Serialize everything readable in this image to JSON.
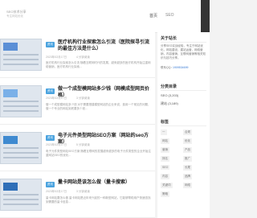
{
  "header": {
    "site_title": "SEO技术分享",
    "site_subtitle": "专注网站优化",
    "nav_home": "首页",
    "nav_more": "SEO"
  },
  "posts": [
    {
      "badge": "资讯",
      "title": "医疗机构行业探索怎么引流（医院探寻引流的最佳方法是什么）",
      "date": "2023年02月17日",
      "meta": "4 分钟阅读",
      "excerpt": "医疗机构行业探索怎么引流 随着互联网时代的发展，越来越多的医疗机构开始注重网络营销，医疗机构行业探索..."
    },
    {
      "badge": "资讯",
      "title": "做一个成型模网站多少钱（网模成型网页价格）",
      "date": "2023年02月17日",
      "meta": "3 分钟阅读",
      "excerpt": "做一个成型模网站多少钱 对于需要搭建模型网站的企业来说，费用一个常见的问题，做一个专业的网站到底要多少钱..."
    },
    {
      "badge": "资讯",
      "title": "电子元件类型网站SEO方案（网站的seo方案）",
      "date": "2023年02月17日",
      "meta": "5 分钟阅读",
      "excerpt": "电子元件类型网站SEO方案 随着互联网的发展越来越多的电子元件类型的企业开始注重网站SEO的优化..."
    },
    {
      "badge": "资讯",
      "title": "量卡网站是该怎么做（量卡搜索）",
      "date": "2023年02月17日",
      "meta": "3 分钟阅读",
      "excerpt": "量卡网站要怎么做 量卡网站是近年来兴起的一种新型网站，它能够帮助用户快速查找到需要的量卡信息..."
    }
  ],
  "sidebar": {
    "about_heading": "关于站长",
    "about_text": "分享SEO实战经验，专注于网站优化，网站建设，建站运营，网络营销，内容营销，互联网营销等相关知识与技巧分享。",
    "contact_label": "联系QQ：",
    "contact_value": "1909534699",
    "categories_heading": "分类目录",
    "categories": [
      {
        "label": "SEO (3,203)"
      },
      {
        "label": "建站 (3,189)"
      }
    ],
    "tags_heading": "标签",
    "tags": [
      "一",
      "合规",
      "网站",
      "优化",
      "营销",
      "产品",
      "排名",
      "推广",
      "SEO",
      "长尾",
      "内容",
      "品牌",
      "关键词",
      "网络",
      "策略"
    ]
  }
}
